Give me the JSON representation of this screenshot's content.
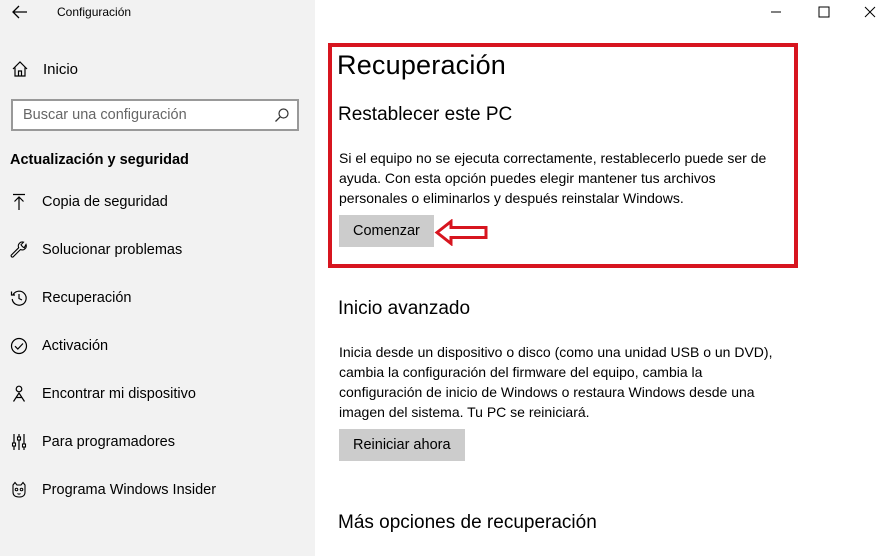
{
  "window": {
    "title": "Configuración"
  },
  "sidebar": {
    "home_label": "Inicio",
    "search_placeholder": "Buscar una configuración",
    "section_title": "Actualización y seguridad",
    "items": [
      {
        "label": "Copia de seguridad",
        "icon": "backup-arrow-icon"
      },
      {
        "label": "Solucionar problemas",
        "icon": "wrench-icon"
      },
      {
        "label": "Recuperación",
        "icon": "recovery-icon"
      },
      {
        "label": "Activación",
        "icon": "check-circle-icon"
      },
      {
        "label": "Encontrar mi dispositivo",
        "icon": "person-pin-icon"
      },
      {
        "label": "Para programadores",
        "icon": "developer-sliders-icon"
      },
      {
        "label": "Programa Windows Insider",
        "icon": "insider-cat-icon"
      }
    ]
  },
  "main": {
    "page_title": "Recuperación",
    "reset": {
      "heading": "Restablecer este PC",
      "description": "Si el equipo no se ejecuta correctamente, restablecerlo puede ser de ayuda. Con esta opción puedes elegir mantener tus archivos personales o eliminarlos y después reinstalar Windows.",
      "button": "Comenzar"
    },
    "advanced": {
      "heading": "Inicio avanzado",
      "description": "Inicia desde un dispositivo o disco (como una unidad USB o un DVD), cambia la configuración del firmware del equipo, cambia la configuración de inicio de Windows o restaura Windows desde una imagen del sistema. Tu PC se reiniciará.",
      "button": "Reiniciar ahora"
    },
    "more_heading": "Más opciones de recuperación"
  },
  "colors": {
    "sidebar_bg": "#f2f2f2",
    "button_bg": "#cccccc",
    "annotation_red": "#d7151f"
  }
}
